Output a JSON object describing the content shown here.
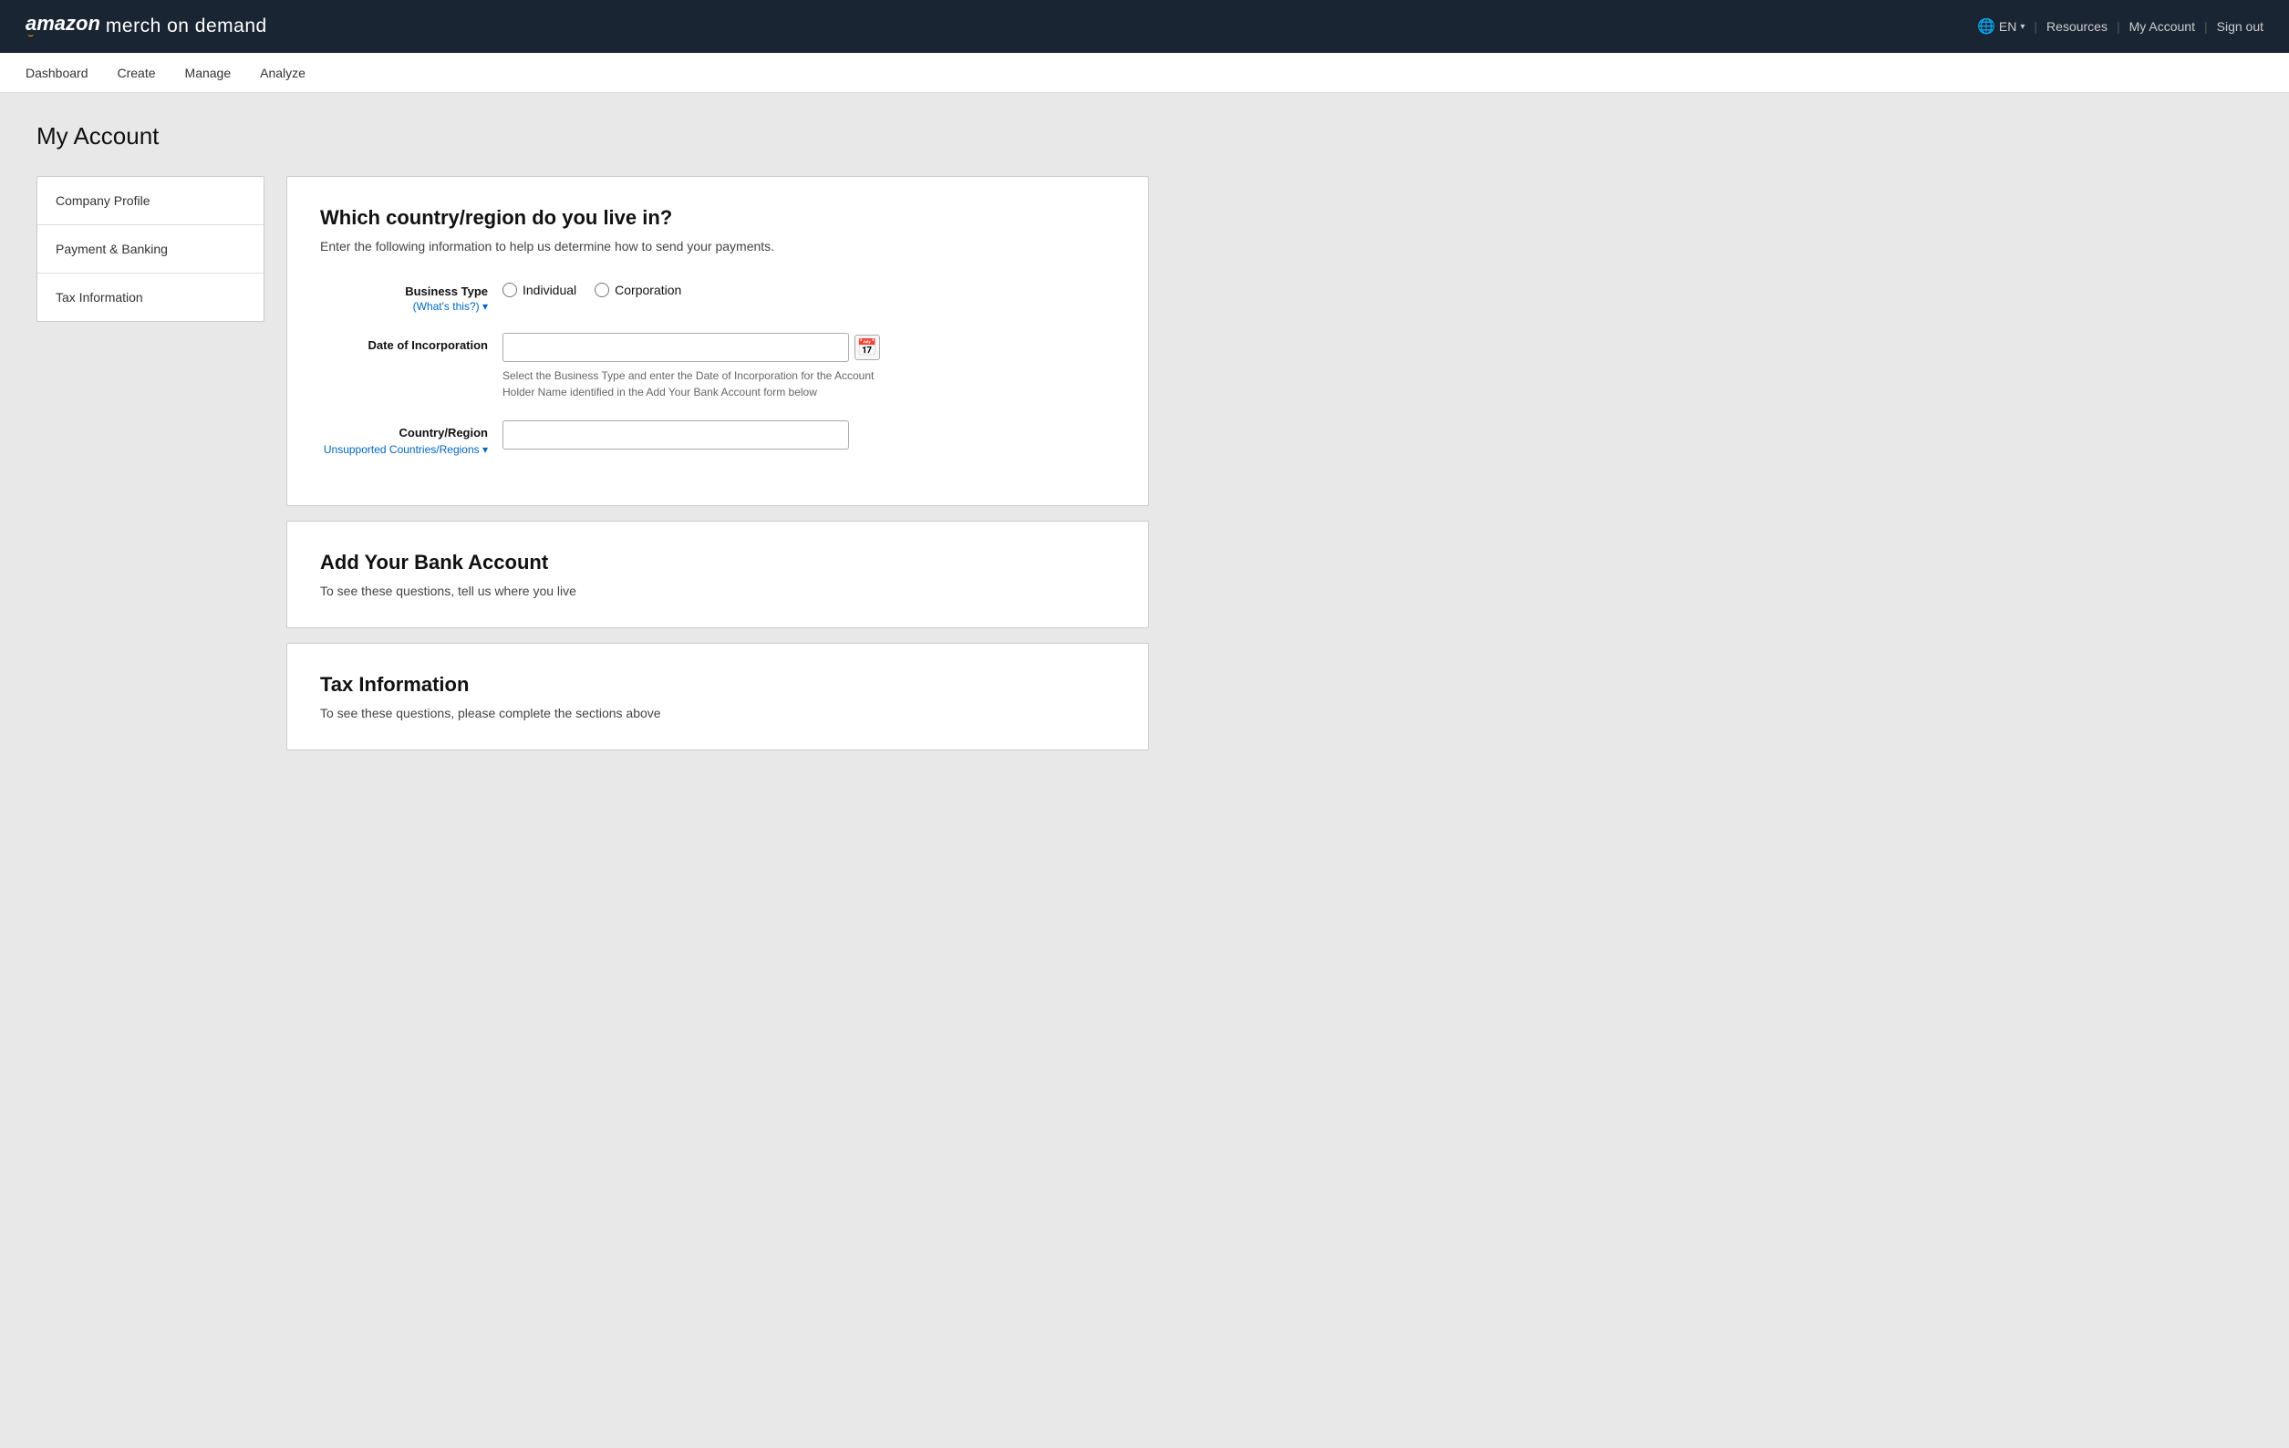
{
  "topNav": {
    "logoAmazon": "amazon",
    "logoMerch": "merch on demand",
    "logoSmile": "⌣",
    "lang": "EN",
    "resources": "Resources",
    "myAccount": "My Account",
    "signOut": "Sign out",
    "globeIcon": "🌐",
    "chevron": "▾"
  },
  "secNav": {
    "items": [
      {
        "label": "Dashboard",
        "key": "dashboard"
      },
      {
        "label": "Create",
        "key": "create"
      },
      {
        "label": "Manage",
        "key": "manage"
      },
      {
        "label": "Analyze",
        "key": "analyze"
      }
    ]
  },
  "pageTitle": "My Account",
  "sidebar": {
    "items": [
      {
        "label": "Company Profile"
      },
      {
        "label": "Payment & Banking"
      },
      {
        "label": "Tax Information"
      }
    ]
  },
  "panels": {
    "countryPanel": {
      "title": "Which country/region do you live in?",
      "subtitle": "Enter the following information to help us determine how to send your payments.",
      "businessTypeLabel": "Business Type",
      "whatsThis": "(What's this?)",
      "individualLabel": "Individual",
      "corporationLabel": "Corporation",
      "dateLabel": "Date of Incorporation",
      "dateHelp": "Select the Business Type and enter the Date of Incorporation for the Account Holder Name identified in the Add Your Bank Account form below",
      "countryLabel": "Country/Region",
      "unsupportedLink": "Unsupported Countries/Regions",
      "unsupportedChevron": "▾",
      "whatsThisChevron": "▾"
    },
    "bankPanel": {
      "title": "Add Your Bank Account",
      "subtitle": "To see these questions, tell us where you live"
    },
    "taxPanel": {
      "title": "Tax Information",
      "subtitle": "To see these questions, please complete the sections above"
    }
  }
}
